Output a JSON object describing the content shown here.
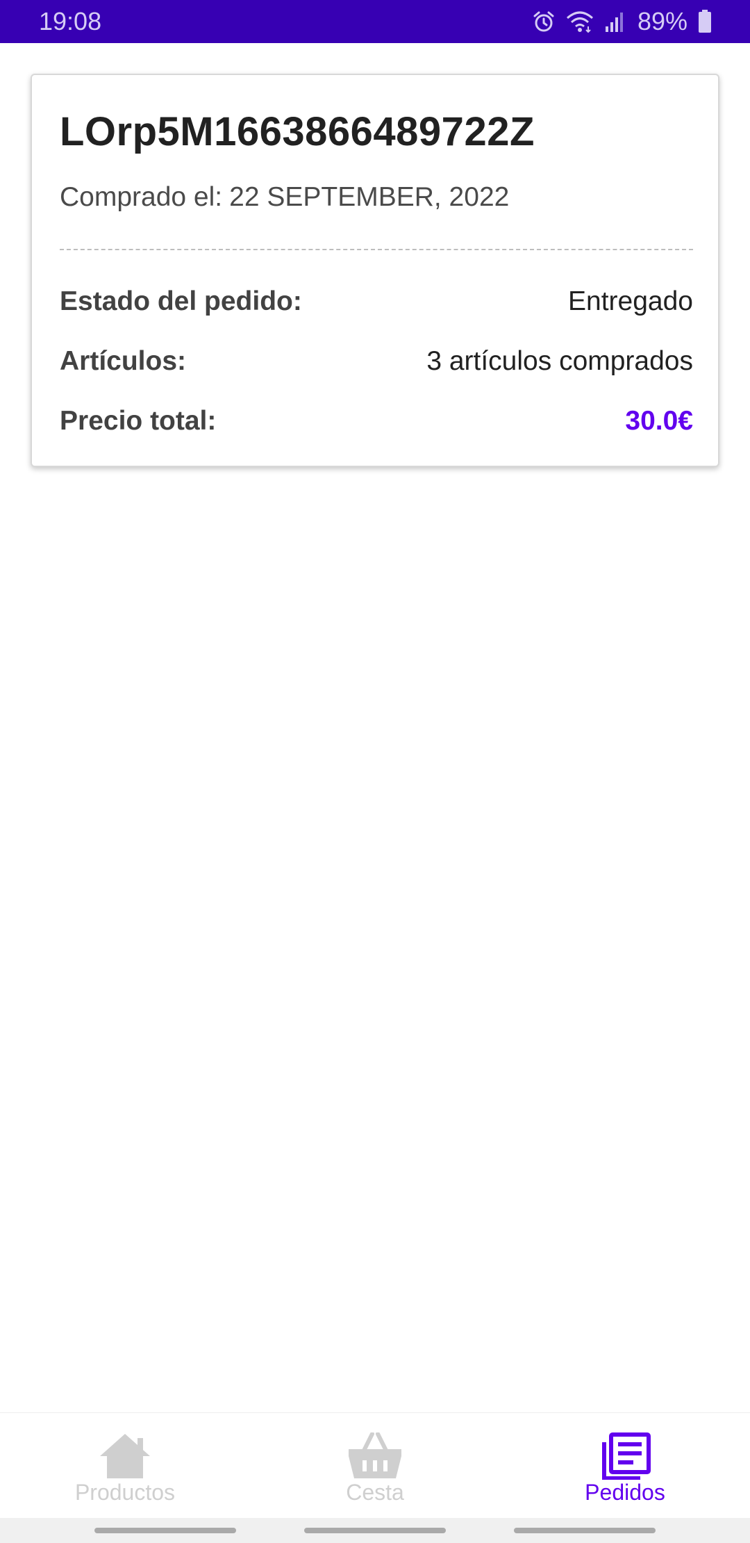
{
  "status_bar": {
    "time": "19:08",
    "battery": "89%",
    "icons": [
      "alarm-icon",
      "wifi-icon",
      "signal-icon",
      "battery-icon"
    ]
  },
  "order": {
    "id": "LOrp5M1663866489722Z",
    "date_label": "Comprado el:",
    "date_value": "22 SEPTEMBER, 2022",
    "status_label": "Estado del pedido:",
    "status_value": "Entregado",
    "items_label": "Artículos:",
    "items_value": "3 artículos comprados",
    "total_label": "Precio total:",
    "total_value": "30.0€"
  },
  "bottom_nav": {
    "items": [
      {
        "label": "Productos",
        "icon": "home-icon",
        "active": false
      },
      {
        "label": "Cesta",
        "icon": "basket-icon",
        "active": false
      },
      {
        "label": "Pedidos",
        "icon": "orders-icon",
        "active": true
      }
    ]
  },
  "colors": {
    "status_bar": "#3700b3",
    "accent": "#6200ee",
    "inactive": "#cfcfcf"
  }
}
